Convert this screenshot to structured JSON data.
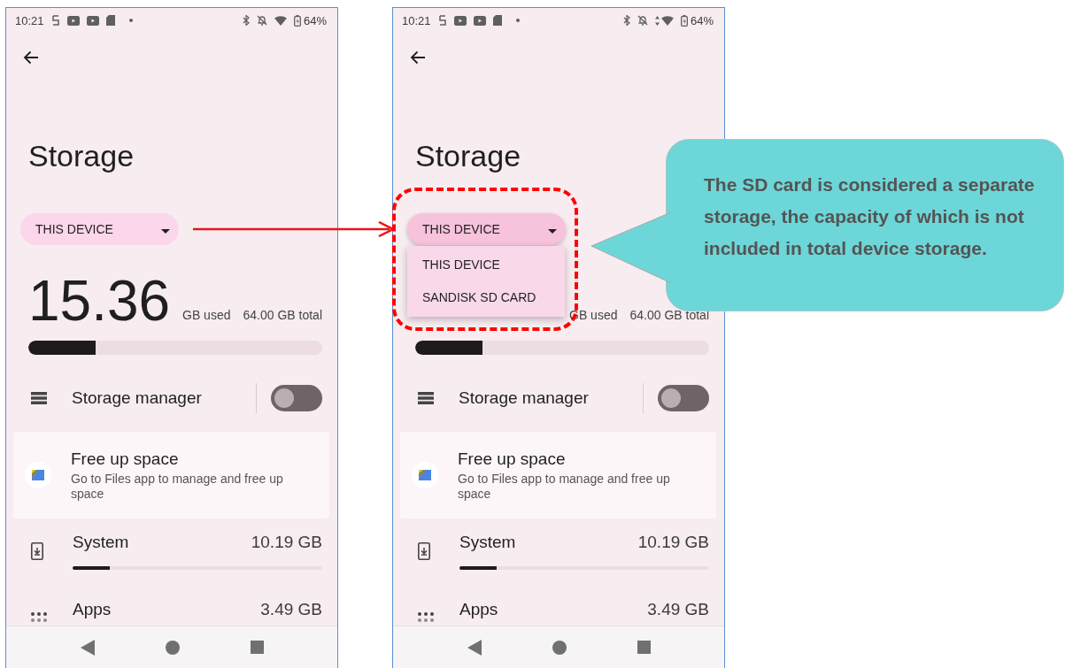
{
  "phones": [
    {
      "status_bar": {
        "time": "10:21",
        "data_activity": false,
        "battery": "64%"
      },
      "title": "Storage",
      "dropdown": {
        "label": "THIS DEVICE",
        "expanded": false
      },
      "usage": {
        "amount": "15.36",
        "used_label": "GB used",
        "total": "64.00 GB total",
        "level": 0.23
      },
      "storage_manager": {
        "label": "Storage manager",
        "on": false
      },
      "free_up": {
        "title": "Free up space",
        "subtitle": "Go to Files app to manage and free up space"
      },
      "categories": [
        {
          "kind": "system",
          "name": "System",
          "size": "10.19 GB",
          "level": 0.15
        },
        {
          "kind": "apps",
          "name": "Apps",
          "size": "3.49 GB"
        }
      ]
    },
    {
      "status_bar": {
        "time": "10:21",
        "data_activity": true,
        "battery": "64%"
      },
      "title": "Storage",
      "dropdown": {
        "label": "THIS DEVICE",
        "expanded": true,
        "options": [
          {
            "label": "THIS DEVICE"
          },
          {
            "label": "SANDISK SD CARD"
          }
        ]
      },
      "usage": {
        "used_label": "GB used",
        "total": "64.00 GB total",
        "level": 0.23
      },
      "storage_manager": {
        "label": "Storage manager",
        "on": false
      },
      "free_up": {
        "title": "Free up space",
        "subtitle": "Go to Files app to manage and free up space"
      },
      "categories": [
        {
          "kind": "system",
          "name": "System",
          "size": "10.19 GB",
          "level": 0.15
        },
        {
          "kind": "apps",
          "name": "Apps",
          "size": "3.49 GB"
        }
      ]
    }
  ],
  "callout": {
    "text": "The SD card is considered a separate storage, the capacity of which is not included in total device storage."
  }
}
